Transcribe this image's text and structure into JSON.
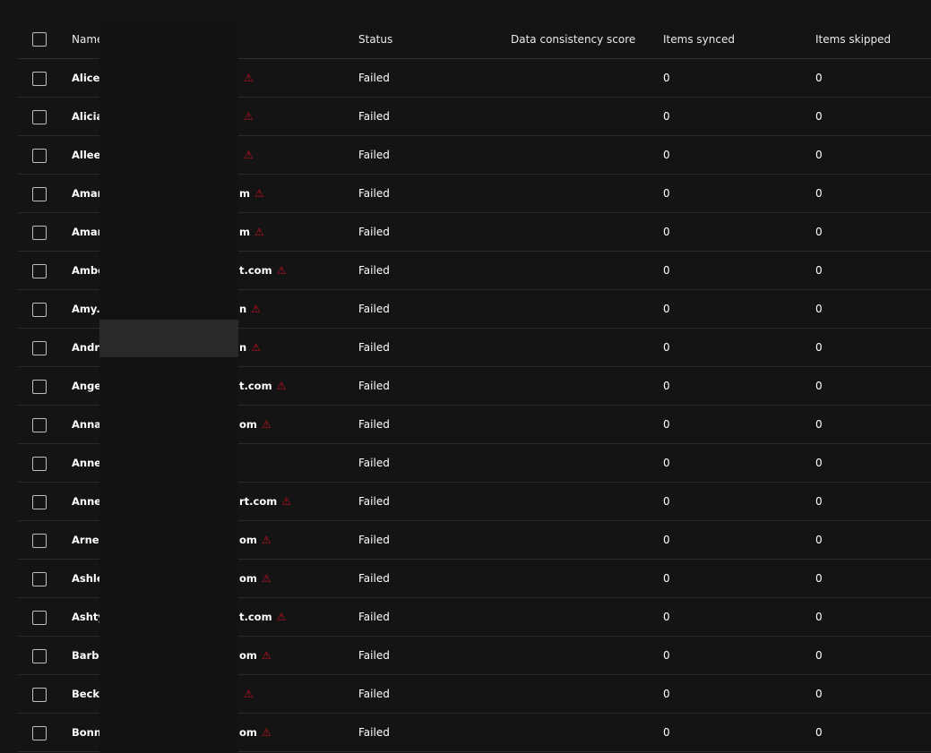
{
  "table": {
    "headers": {
      "name": "Name",
      "status": "Status",
      "score": "Data consistency score",
      "synced": "Items synced",
      "skipped": "Items skipped"
    },
    "colors": {
      "warning": "#c50f1f",
      "background": "#141414"
    },
    "warning_icon": "warning-triangle-icon",
    "rows": [
      {
        "name_prefix": "Alice.S",
        "name_suffix": "",
        "warning": true,
        "status": "Failed",
        "score": "",
        "synced": "0",
        "skipped": "0"
      },
      {
        "name_prefix": "Alicia.",
        "name_suffix": "",
        "warning": true,
        "status": "Failed",
        "score": "",
        "synced": "0",
        "skipped": "0"
      },
      {
        "name_prefix": "Alleen",
        "name_suffix": "",
        "warning": true,
        "status": "Failed",
        "score": "",
        "synced": "0",
        "skipped": "0"
      },
      {
        "name_prefix": "Aman",
        "name_suffix": "m",
        "warning": true,
        "status": "Failed",
        "score": "",
        "synced": "0",
        "skipped": "0"
      },
      {
        "name_prefix": "Aman",
        "name_suffix": "m",
        "warning": true,
        "status": "Failed",
        "score": "",
        "synced": "0",
        "skipped": "0"
      },
      {
        "name_prefix": "Ambe",
        "name_suffix": "t.com",
        "warning": true,
        "status": "Failed",
        "score": "",
        "synced": "0",
        "skipped": "0"
      },
      {
        "name_prefix": "Amy.D",
        "name_suffix": "n",
        "warning": true,
        "status": "Failed",
        "score": "",
        "synced": "0",
        "skipped": "0"
      },
      {
        "name_prefix": "Andre",
        "name_suffix": "n",
        "warning": true,
        "status": "Failed",
        "score": "",
        "synced": "0",
        "skipped": "0"
      },
      {
        "name_prefix": "Angel",
        "name_suffix": "t.com",
        "warning": true,
        "status": "Failed",
        "score": "",
        "synced": "0",
        "skipped": "0"
      },
      {
        "name_prefix": "Anna.",
        "name_suffix": "om",
        "warning": true,
        "status": "Failed",
        "score": "",
        "synced": "0",
        "skipped": "0"
      },
      {
        "name_prefix": "Anne.",
        "name_suffix": "",
        "warning": false,
        "status": "Failed",
        "score": "",
        "synced": "0",
        "skipped": "0"
      },
      {
        "name_prefix": "Annet",
        "name_suffix": "rt.com",
        "warning": true,
        "status": "Failed",
        "score": "",
        "synced": "0",
        "skipped": "0"
      },
      {
        "name_prefix": "Arnec",
        "name_suffix": "om",
        "warning": true,
        "status": "Failed",
        "score": "",
        "synced": "0",
        "skipped": "0"
      },
      {
        "name_prefix": "Ashley",
        "name_suffix": "om",
        "warning": true,
        "status": "Failed",
        "score": "",
        "synced": "0",
        "skipped": "0"
      },
      {
        "name_prefix": "Ashty",
        "name_suffix": "t.com",
        "warning": true,
        "status": "Failed",
        "score": "",
        "synced": "0",
        "skipped": "0"
      },
      {
        "name_prefix": "Barba",
        "name_suffix": "om",
        "warning": true,
        "status": "Failed",
        "score": "",
        "synced": "0",
        "skipped": "0"
      },
      {
        "name_prefix": "Becky",
        "name_suffix": "",
        "warning": true,
        "status": "Failed",
        "score": "",
        "synced": "0",
        "skipped": "0"
      },
      {
        "name_prefix": "Bonni",
        "name_suffix": "om",
        "warning": true,
        "status": "Failed",
        "score": "",
        "synced": "0",
        "skipped": "0"
      }
    ]
  }
}
